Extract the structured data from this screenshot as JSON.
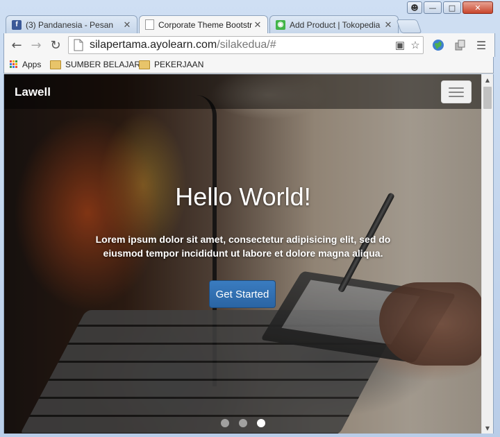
{
  "tabs": [
    {
      "title": "(3) Pandanesia - Pesan",
      "icon": "facebook-icon",
      "color": "#3b5998",
      "active": false
    },
    {
      "title": "Corporate Theme Bootstr",
      "icon": "page-icon",
      "color": "#ffffff",
      "active": true
    },
    {
      "title": "Add Product | Tokopedia",
      "icon": "tokopedia-icon",
      "color": "#42b549",
      "active": false
    }
  ],
  "toolbar": {
    "back": "←",
    "forward": "→",
    "reload": "↻",
    "url_host": "silapertama.ayolearn.com",
    "url_path": "/silakedua/#"
  },
  "bookmarks": {
    "apps": "Apps",
    "items": [
      "SUMBER BELAJAR",
      "PEKERJAAN"
    ]
  },
  "site": {
    "brand": "Lawell",
    "hero_title": "Hello World!",
    "hero_text": "Lorem ipsum dolor sit amet, consectetur adipisicing elit, sed do eiusmod tempor incididunt ut labore et dolore magna aliqua.",
    "cta_label": "Get Started",
    "carousel_active_index": 2,
    "carousel_count": 3
  }
}
